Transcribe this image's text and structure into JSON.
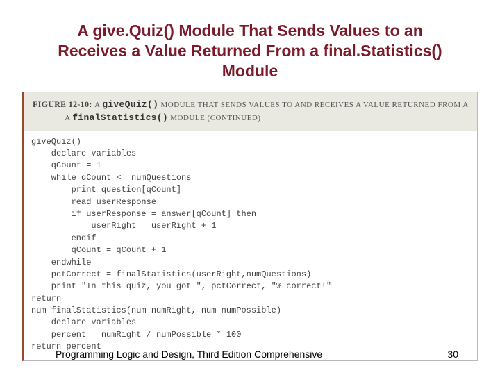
{
  "title": "A give.Quiz() Module That Sends Values to an Receives a Value Returned From a final.Statistics() Module",
  "figure": {
    "label": "Figure 12-10:",
    "caption_prefix": "A ",
    "mono1": "giveQuiz()",
    "caption_mid": " module that sends values to and receives a value returned from a ",
    "mono2": "finalStatistics()",
    "caption_suffix": " module (continued)"
  },
  "code": "giveQuiz()\n    declare variables\n    qCount = 1\n    while qCount <= numQuestions\n        print question[qCount]\n        read userResponse\n        if userResponse = answer[qCount] then\n            userRight = userRight + 1\n        endif\n        qCount = qCount + 1\n    endwhile\n    pctCorrect = finalStatistics(userRight,numQuestions)\n    print \"In this quiz, you got \", pctCorrect, \"% correct!\"\nreturn\nnum finalStatistics(num numRight, num numPossible)\n    declare variables\n    percent = numRight / numPossible * 100\nreturn percent",
  "footer": {
    "text": "Programming Logic and Design, Third Edition Comprehensive",
    "page": "30"
  }
}
